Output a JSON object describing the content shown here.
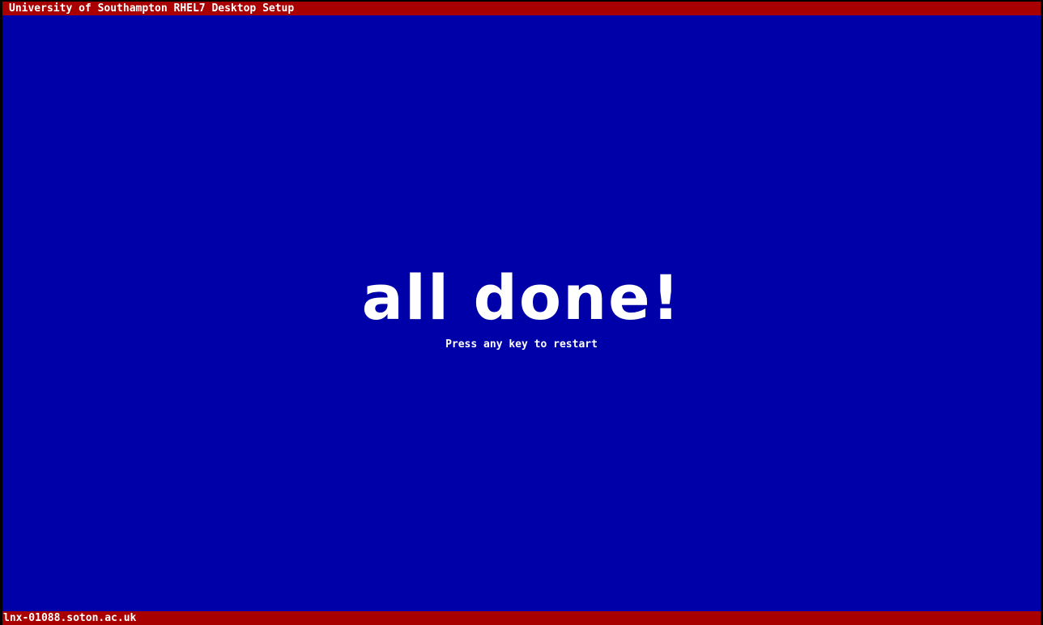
{
  "window": {
    "title": "University of Southampton RHEL7 Desktop Setup"
  },
  "main": {
    "headline": "all done!",
    "prompt": "Press any key to restart"
  },
  "status_bar": {
    "hostname": "lnx-01088.soton.ac.uk"
  },
  "colors": {
    "background": "#0000a8",
    "bar": "#a80000",
    "text": "#ffffff"
  }
}
